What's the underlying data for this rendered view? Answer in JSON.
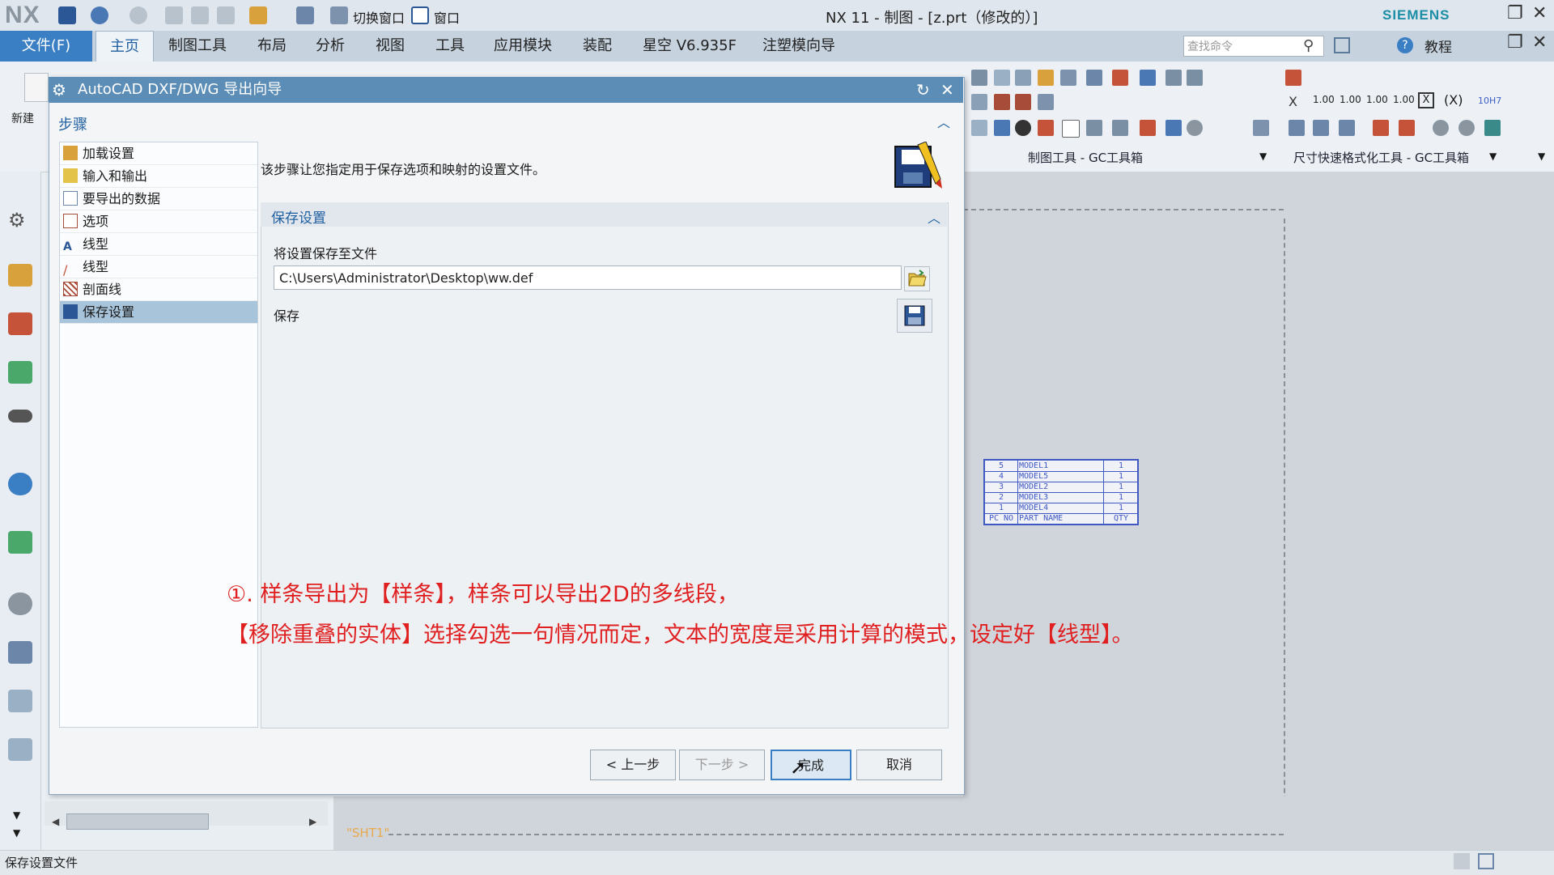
{
  "app": {
    "logo": "NX",
    "window_title": "NX 11 - 制图 - [z.prt（修改的）]",
    "brand": "SIEMENS",
    "quick_access": [
      "切换窗口",
      "窗口"
    ]
  },
  "menu": {
    "file": "文件(F)",
    "tabs": [
      "主页",
      "制图工具",
      "布局",
      "分析",
      "视图",
      "工具",
      "应用模块",
      "装配",
      "星空 V6.935F",
      "注塑模向导"
    ],
    "search_placeholder": "查找命令",
    "tutorial": "教程"
  },
  "ribbon": {
    "new_label": "新建",
    "groups": [
      "制图工具 - GC工具箱",
      "尺寸快速格式化工具 - GC工具箱"
    ],
    "dim_labels": [
      "1.00",
      "1.00",
      "1.00",
      "1.00",
      "10H7"
    ]
  },
  "dialog": {
    "title": "AutoCAD DXF/DWG 导出向导",
    "steps_header": "步骤",
    "steps": [
      {
        "label": "加载设置"
      },
      {
        "label": "输入和输出"
      },
      {
        "label": "要导出的数据"
      },
      {
        "label": "选项"
      },
      {
        "label": "线型"
      },
      {
        "label": "线型"
      },
      {
        "label": "剖面线"
      },
      {
        "label": "保存设置",
        "selected": true
      }
    ],
    "description": "该步骤让您指定用于保存选项和映射的设置文件。",
    "section_title": "保存设置",
    "save_to_file_label": "将设置保存至文件",
    "file_path": "C:\\Users\\Administrator\\Desktop\\ww.def",
    "save_label": "保存",
    "buttons": {
      "back": "< 上一步",
      "next": "下一步 >",
      "finish": "完成",
      "cancel": "取消"
    }
  },
  "drawing": {
    "sheet_label": "\"SHT1\"",
    "parts_list": {
      "rows": [
        {
          "pc": "5",
          "name": "MODEL1",
          "qty": "1"
        },
        {
          "pc": "4",
          "name": "MODEL5",
          "qty": "1"
        },
        {
          "pc": "3",
          "name": "MODEL2",
          "qty": "1"
        },
        {
          "pc": "2",
          "name": "MODEL3",
          "qty": "1"
        },
        {
          "pc": "1",
          "name": "MODEL4",
          "qty": "1"
        }
      ],
      "header": {
        "pc": "PC NO",
        "name": "PART NAME",
        "qty": "QTY"
      }
    }
  },
  "annotation": {
    "line1": "①. 样条导出为【样条】，样条可以导出2D的多线段，",
    "line2": "【移除重叠的实体】选择勾选一句情况而定，文本的宽度是采用计算的模式，设定好【线型】。"
  },
  "status": {
    "text": "保存设置文件"
  },
  "colors": {
    "accent": "#3a7fc4",
    "dialog_title": "#5b8db6",
    "annotation": "#e02020",
    "parts_list": "#3f58c4"
  }
}
